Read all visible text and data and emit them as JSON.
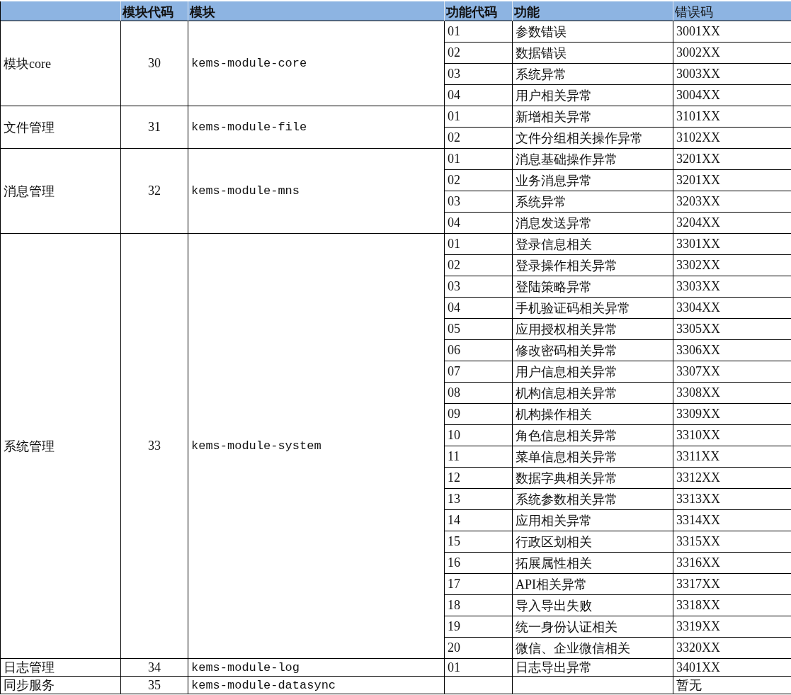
{
  "columns": [
    "",
    "模块代码",
    "模块",
    "功能代码",
    "功能",
    "错误码"
  ],
  "modules": [
    {
      "name": "模块core",
      "code": "30",
      "package": "kems-module-core",
      "functions": [
        {
          "code": "01",
          "name": "参数错误",
          "error_code": "3001XX"
        },
        {
          "code": "02",
          "name": "数据错误",
          "error_code": "3002XX"
        },
        {
          "code": "03",
          "name": "系统异常",
          "error_code": "3003XX"
        },
        {
          "code": "04",
          "name": "用户相关异常",
          "error_code": "3004XX"
        }
      ]
    },
    {
      "name": "文件管理",
      "code": "31",
      "package": "kems-module-file",
      "functions": [
        {
          "code": "01",
          "name": "新增相关异常",
          "error_code": "3101XX"
        },
        {
          "code": "02",
          "name": "文件分组相关操作异常",
          "error_code": "3102XX"
        }
      ]
    },
    {
      "name": "消息管理",
      "code": "32",
      "package": "kems-module-mns",
      "functions": [
        {
          "code": "01",
          "name": "消息基础操作异常",
          "error_code": "3201XX"
        },
        {
          "code": "02",
          "name": "业务消息异常",
          "error_code": "3201XX"
        },
        {
          "code": "03",
          "name": "系统异常",
          "error_code": "3203XX"
        },
        {
          "code": "04",
          "name": "消息发送异常",
          "error_code": "3204XX"
        }
      ]
    },
    {
      "name": "系统管理",
      "code": "33",
      "package": "kems-module-system",
      "functions": [
        {
          "code": "01",
          "name": "登录信息相关",
          "error_code": "3301XX"
        },
        {
          "code": "02",
          "name": "登录操作相关异常",
          "error_code": "3302XX"
        },
        {
          "code": "03",
          "name": "登陆策略异常",
          "error_code": "3303XX"
        },
        {
          "code": "04",
          "name": "手机验证码相关异常",
          "error_code": "3304XX"
        },
        {
          "code": "05",
          "name": "应用授权相关异常",
          "error_code": "3305XX"
        },
        {
          "code": "06",
          "name": "修改密码相关异常",
          "error_code": "3306XX"
        },
        {
          "code": "07",
          "name": "用户信息相关异常",
          "error_code": "3307XX"
        },
        {
          "code": "08",
          "name": "机构信息相关异常",
          "error_code": "3308XX"
        },
        {
          "code": "09",
          "name": "机构操作相关",
          "error_code": "3309XX"
        },
        {
          "code": "10",
          "name": "角色信息相关异常",
          "error_code": "3310XX"
        },
        {
          "code": "11",
          "name": "菜单信息相关异常",
          "error_code": "3311XX"
        },
        {
          "code": "12",
          "name": "数据字典相关异常",
          "error_code": "3312XX"
        },
        {
          "code": "13",
          "name": "系统参数相关异常",
          "error_code": "3313XX"
        },
        {
          "code": "14",
          "name": "应用相关异常",
          "error_code": "3314XX"
        },
        {
          "code": "15",
          "name": "行政区划相关",
          "error_code": "3315XX"
        },
        {
          "code": "16",
          "name": "拓展属性相关",
          "error_code": "3316XX"
        },
        {
          "code": "17",
          "name": "API相关异常",
          "error_code": "3317XX"
        },
        {
          "code": "18",
          "name": "导入导出失败",
          "error_code": "3318XX"
        },
        {
          "code": "19",
          "name": "统一身份认证相关",
          "error_code": "3319XX"
        },
        {
          "code": "20",
          "name": "微信、企业微信相关",
          "error_code": "3320XX"
        }
      ]
    },
    {
      "name": "日志管理",
      "code": "34",
      "package": "kems-module-log",
      "functions": [
        {
          "code": "01",
          "name": "日志导出异常",
          "error_code": "3401XX"
        }
      ]
    },
    {
      "name": "同步服务",
      "code": "35",
      "package": "kems-module-datasync",
      "functions": [
        {
          "error_code": "暂无"
        }
      ]
    }
  ]
}
